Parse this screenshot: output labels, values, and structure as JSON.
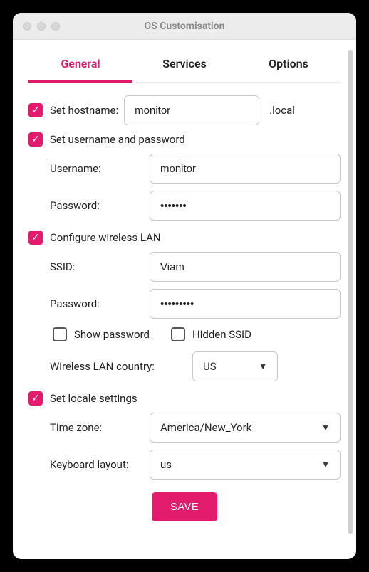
{
  "window": {
    "title": "OS Customisation"
  },
  "tabs": {
    "general": "General",
    "services": "Services",
    "options": "Options"
  },
  "hostname": {
    "checkbox_label": "Set hostname:",
    "value": "monitor",
    "suffix": ".local"
  },
  "credentials": {
    "header": "Set username and password",
    "username_label": "Username:",
    "username_value": "monitor",
    "password_label": "Password:",
    "password_value": "•••••••"
  },
  "wifi": {
    "header": "Configure wireless LAN",
    "ssid_label": "SSID:",
    "ssid_value": "Viam",
    "password_label": "Password:",
    "password_value": "•••••••••",
    "show_password": "Show password",
    "hidden_ssid": "Hidden SSID",
    "country_label": "Wireless LAN country:",
    "country_value": "US"
  },
  "locale": {
    "header": "Set locale settings",
    "tz_label": "Time zone:",
    "tz_value": "America/New_York",
    "kb_label": "Keyboard layout:",
    "kb_value": "us"
  },
  "save_label": "SAVE"
}
